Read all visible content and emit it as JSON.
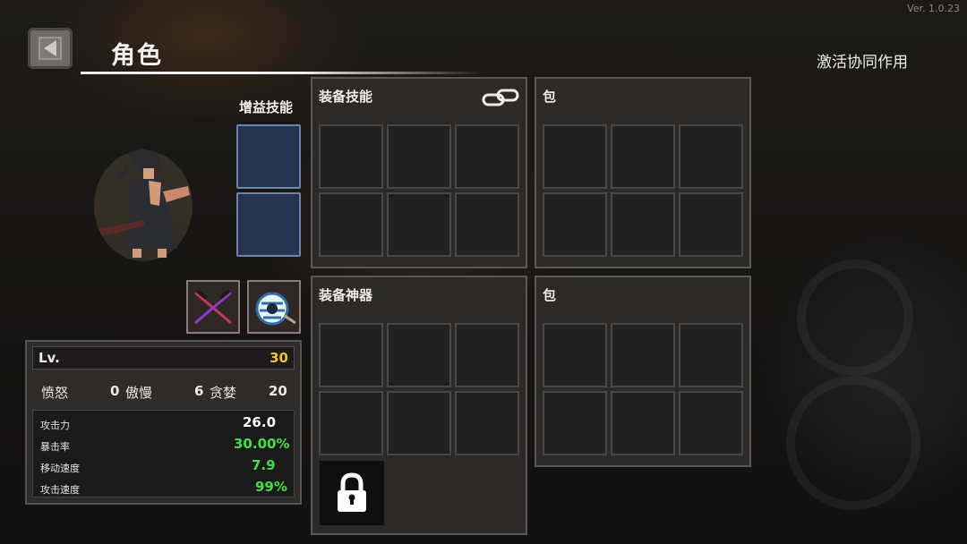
{
  "version": "Ver. 1.0.23",
  "header": {
    "title": "角色",
    "synergy_label": "激活协同作用"
  },
  "buff_skills": {
    "label": "增益技能",
    "slots": 2
  },
  "weapons": [
    {
      "icon": "crossed-swords-icon"
    },
    {
      "icon": "scroll-artifact-icon"
    }
  ],
  "stats": {
    "level_label": "Lv.",
    "level_value": "30",
    "traits": [
      {
        "label": "愤怒",
        "value": "0"
      },
      {
        "label": "傲慢",
        "value": "6"
      },
      {
        "label": "贪婪",
        "value": "20"
      }
    ],
    "attributes": [
      {
        "label": "攻击力",
        "value": "26.0",
        "color": "#ffffff"
      },
      {
        "label": "暴击率",
        "value": "30.00%",
        "color": "#3fe23f"
      },
      {
        "label": "移动速度",
        "value": "7.9",
        "color": "#3fe23f"
      },
      {
        "label": "攻击速度",
        "value": "99%",
        "color": "#3fe23f"
      }
    ]
  },
  "panels": {
    "equip_skills": {
      "title": "装备技能",
      "icon": "link-chain-icon"
    },
    "bag_top": {
      "title": "包"
    },
    "equip_artifacts": {
      "title": "装备神器",
      "icon": "lock-icon"
    },
    "bag_bottom": {
      "title": "包"
    }
  },
  "colors": {
    "accent_gold": "#f2c230",
    "stat_green": "#3fe23f",
    "buff_slot": "#253550"
  }
}
